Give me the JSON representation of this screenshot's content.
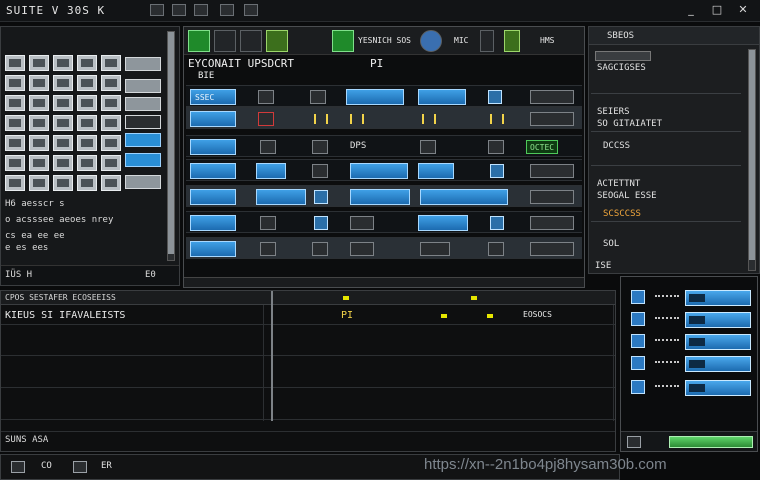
{
  "window": {
    "title": "SUITE V 30S K",
    "controls": {
      "minimize": "_",
      "maximize": "□",
      "close": "✕"
    }
  },
  "left_panel": {
    "lines": [
      "H6 aesscr s",
      "o acsssee aeoes nrey",
      "cs ea  ee ee",
      "e es  ees"
    ],
    "status": "IÜS  Н",
    "status_value": "E0"
  },
  "grid_panel": {
    "toolbar": {
      "label1": "YESNICH SOS",
      "label2": "MIC",
      "label3": "HMS"
    },
    "header": {
      "title": "EYCONAIT UPSDCRT",
      "col": "PI",
      "sub": "BIE"
    },
    "rows": [
      {
        "cell1": "SSEC",
        "cell2": "",
        "text": ""
      },
      {
        "cell1": "",
        "cell2": "",
        "text": ""
      },
      {
        "cell1": "",
        "cell2": "",
        "text": "DPS",
        "green": "OCTEC"
      },
      {
        "cell1": "",
        "cell2": "",
        "text": ""
      },
      {
        "cell1": "",
        "cell2": "",
        "text": ""
      },
      {
        "cell1": "",
        "cell2": "",
        "text": ""
      },
      {
        "cell1": "",
        "cell2": "",
        "text": ""
      }
    ]
  },
  "right_panel": {
    "header": "SBEOS",
    "items": [
      "SAGCIGSES",
      "SEIERS",
      "SO  GITAIATET",
      "DCCSS",
      "ACTETTNT",
      "SEOGAL ESSE",
      "SCSCCSS",
      "SOL"
    ],
    "footer": "ISE"
  },
  "timeline": {
    "ruler_label": "CPOS SESTAFER ECOSEEISS",
    "track1_label": "KIEUS SI IFAVALEISTS",
    "track1_clip": "PI",
    "track1_right": "EOSOCS"
  },
  "status_bar": {
    "label": "SUNS  ASA",
    "items": [
      "CO",
      "ER"
    ]
  },
  "watermark": "https://xn--2n1bo4pj8hysam30b.com",
  "colors": {
    "accent_blue": "#2a8fd6",
    "accent_green": "#4ec95a",
    "accent_yellow": "#f2d34a",
    "background": "#0a0b0c"
  }
}
